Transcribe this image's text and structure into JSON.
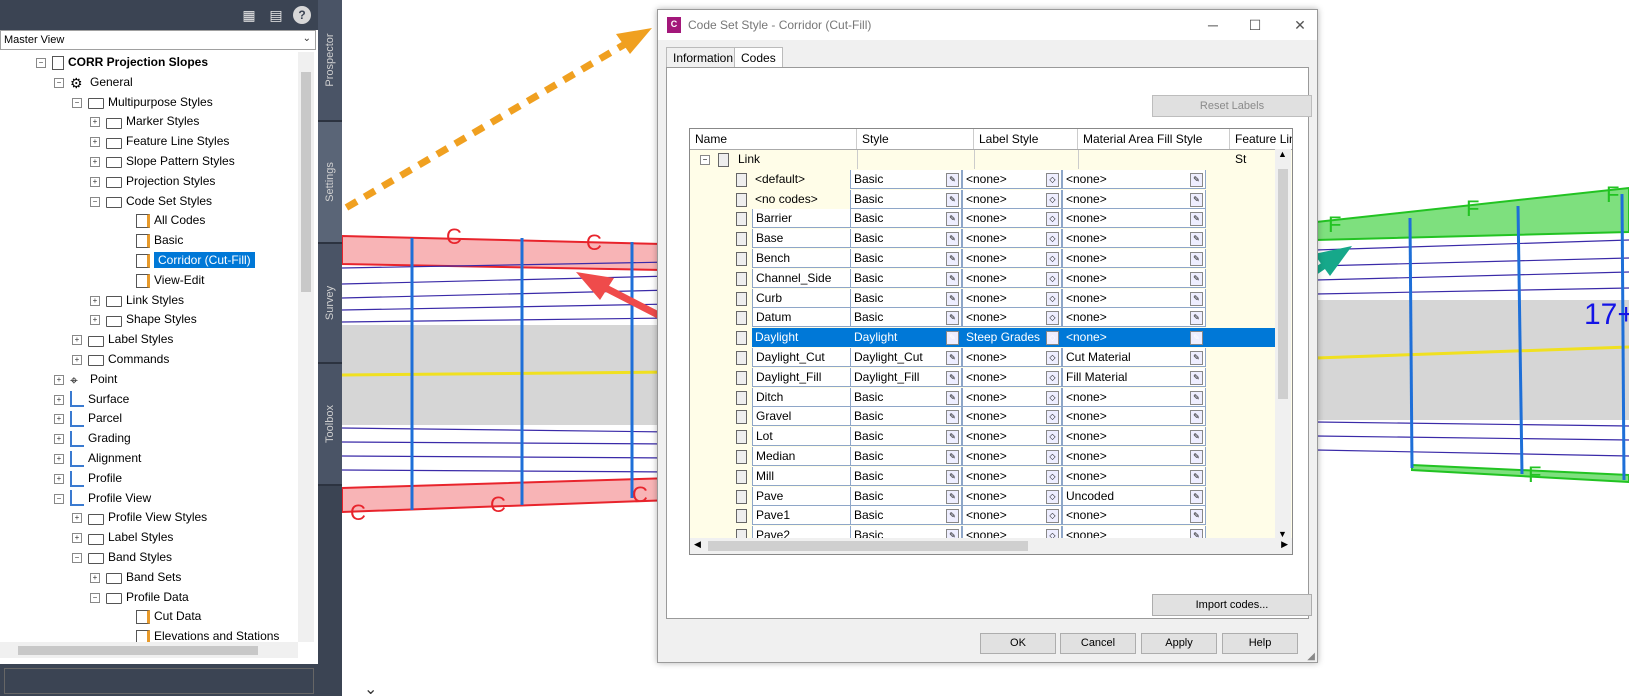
{
  "toolspace": {
    "toolbar_icons": [
      "panel-icon",
      "display-icon",
      "help-icon"
    ],
    "view_select": "Master View",
    "tree": [
      {
        "label": "CORR Projection Slopes",
        "level": 0,
        "icon": "drawing-icon",
        "bold": true
      },
      {
        "label": "General",
        "level": 1,
        "icon": "gear-icon"
      },
      {
        "label": "Multipurpose Styles",
        "level": 2,
        "icon": "folder-icon"
      },
      {
        "label": "Marker Styles",
        "level": 3,
        "icon": "folder-icon"
      },
      {
        "label": "Feature Line Styles",
        "level": 3,
        "icon": "folder-icon"
      },
      {
        "label": "Slope Pattern Styles",
        "level": 3,
        "icon": "folder-icon"
      },
      {
        "label": "Projection Styles",
        "level": 3,
        "icon": "folder-icon"
      },
      {
        "label": "Code Set Styles",
        "level": 3,
        "icon": "folder-icon"
      },
      {
        "label": "All Codes",
        "level": 4,
        "icon": "style-icon"
      },
      {
        "label": "Basic",
        "level": 4,
        "icon": "style-icon"
      },
      {
        "label": "Corridor (Cut-Fill)",
        "level": 4,
        "icon": "style-icon",
        "selected": true
      },
      {
        "label": "View-Edit",
        "level": 4,
        "icon": "style-icon"
      },
      {
        "label": "Link Styles",
        "level": 3,
        "icon": "folder-icon"
      },
      {
        "label": "Shape Styles",
        "level": 3,
        "icon": "folder-icon"
      },
      {
        "label": "Label Styles",
        "level": 2,
        "icon": "folder-icon"
      },
      {
        "label": "Commands",
        "level": 2,
        "icon": "folder-icon"
      },
      {
        "label": "Point",
        "level": 1,
        "icon": "point-icon"
      },
      {
        "label": "Surface",
        "level": 1,
        "icon": "surface-icon"
      },
      {
        "label": "Parcel",
        "level": 1,
        "icon": "parcel-icon"
      },
      {
        "label": "Grading",
        "level": 1,
        "icon": "grading-icon"
      },
      {
        "label": "Alignment",
        "level": 1,
        "icon": "alignment-icon"
      },
      {
        "label": "Profile",
        "level": 1,
        "icon": "profile-icon"
      },
      {
        "label": "Profile View",
        "level": 1,
        "icon": "profile-view-icon"
      },
      {
        "label": "Profile View Styles",
        "level": 2,
        "icon": "folder-icon"
      },
      {
        "label": "Label Styles",
        "level": 2,
        "icon": "folder-icon"
      },
      {
        "label": "Band Styles",
        "level": 2,
        "icon": "folder-icon"
      },
      {
        "label": "Band Sets",
        "level": 3,
        "icon": "folder-icon"
      },
      {
        "label": "Profile Data",
        "level": 3,
        "icon": "folder-icon"
      },
      {
        "label": "Cut Data",
        "level": 4,
        "icon": "band-icon"
      },
      {
        "label": "Elevations and Stations",
        "level": 4,
        "icon": "band-icon"
      }
    ],
    "vertical_tabs": [
      "Prospector",
      "Settings",
      "Survey",
      "Toolbox"
    ]
  },
  "drawing": {
    "left_labels": [
      "C",
      "C",
      "C",
      "C",
      "C"
    ],
    "right_labels": [
      "F",
      "F",
      "F",
      "F"
    ],
    "station_label": "17+"
  },
  "dialog": {
    "title": "Code Set Style - Corridor (Cut-Fill)",
    "tabs": [
      "Information",
      "Codes"
    ],
    "active_tab": "Codes",
    "reset_labels": "Reset Labels",
    "import_codes": "Import codes...",
    "columns": [
      "Name",
      "Style",
      "Label Style",
      "Material Area Fill Style",
      "Feature Line St"
    ],
    "group": "Link",
    "rows": [
      {
        "name": "<default>",
        "style": "Basic",
        "label": "<none>",
        "fill": "<none>"
      },
      {
        "name": "<no codes>",
        "style": "Basic",
        "label": "<none>",
        "fill": "<none>"
      },
      {
        "name": "Barrier",
        "style": "Basic",
        "label": "<none>",
        "fill": "<none>"
      },
      {
        "name": "Base",
        "style": "Basic",
        "label": "<none>",
        "fill": "<none>"
      },
      {
        "name": "Bench",
        "style": "Basic",
        "label": "<none>",
        "fill": "<none>"
      },
      {
        "name": "Channel_Side",
        "style": "Basic",
        "label": "<none>",
        "fill": "<none>"
      },
      {
        "name": "Curb",
        "style": "Basic",
        "label": "<none>",
        "fill": "<none>"
      },
      {
        "name": "Datum",
        "style": "Basic",
        "label": "<none>",
        "fill": "<none>"
      },
      {
        "name": "Daylight",
        "style": "Daylight",
        "label": "Steep Grades",
        "fill": "<none>",
        "selected": true
      },
      {
        "name": "Daylight_Cut",
        "style": "Daylight_Cut",
        "label": "<none>",
        "fill": "Cut Material"
      },
      {
        "name": "Daylight_Fill",
        "style": "Daylight_Fill",
        "label": "<none>",
        "fill": "Fill Material"
      },
      {
        "name": "Ditch",
        "style": "Basic",
        "label": "<none>",
        "fill": "<none>"
      },
      {
        "name": "Gravel",
        "style": "Basic",
        "label": "<none>",
        "fill": "<none>"
      },
      {
        "name": "Lot",
        "style": "Basic",
        "label": "<none>",
        "fill": "<none>"
      },
      {
        "name": "Median",
        "style": "Basic",
        "label": "<none>",
        "fill": "<none>"
      },
      {
        "name": "Mill",
        "style": "Basic",
        "label": "<none>",
        "fill": "<none>"
      },
      {
        "name": "Pave",
        "style": "Basic",
        "label": "<none>",
        "fill": "Uncoded"
      },
      {
        "name": "Pave1",
        "style": "Basic",
        "label": "<none>",
        "fill": "<none>"
      },
      {
        "name": "Pave2",
        "style": "Basic",
        "label": "<none>",
        "fill": "<none>"
      }
    ],
    "buttons": [
      "OK",
      "Cancel",
      "Apply",
      "Help"
    ]
  },
  "colors": {
    "selection": "#0078d7",
    "cut": "#e8242c",
    "fill": "#22c322",
    "arrow_orange": "#f0a020",
    "arrow_red": "#ef4b4b",
    "arrow_teal": "#16a88a"
  }
}
